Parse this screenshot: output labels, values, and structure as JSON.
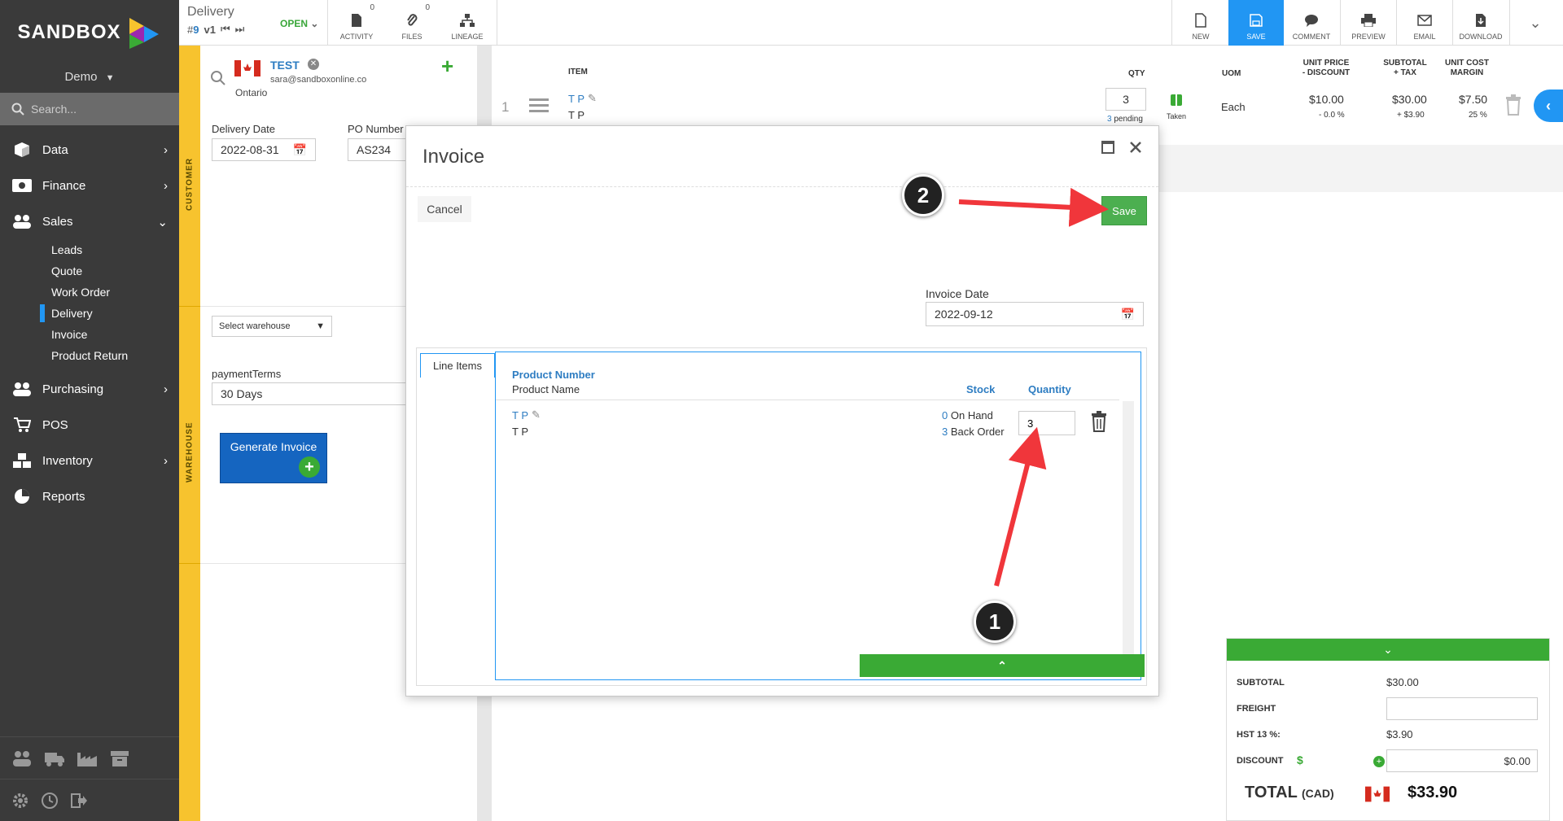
{
  "app": {
    "brand": "SANDBOX",
    "company": "Demo",
    "search_placeholder": "Search..."
  },
  "nav": {
    "data": "Data",
    "finance": "Finance",
    "sales": "Sales",
    "sales_sub": [
      "Leads",
      "Quote",
      "Work Order",
      "Delivery",
      "Invoice",
      "Product Return"
    ],
    "purchasing": "Purchasing",
    "pos": "POS",
    "inventory": "Inventory",
    "reports": "Reports"
  },
  "doc": {
    "type": "Delivery",
    "hash": "#",
    "number": "9",
    "version": "v1",
    "status": "OPEN"
  },
  "toolbar": {
    "activity": "ACTIVITY",
    "activity_count": "0",
    "files": "FILES",
    "files_count": "0",
    "lineage": "LINEAGE",
    "new": "NEW",
    "save": "SAVE",
    "comment": "COMMENT",
    "preview": "PREVIEW",
    "email": "EMAIL",
    "download": "DOWNLOAD"
  },
  "customer": {
    "name": "TEST",
    "email": "sara@sandboxonline.co",
    "province": "Ontario",
    "strip_label": "CUSTOMER",
    "delivery_date_label": "Delivery Date",
    "delivery_date": "2022-08-31",
    "po_label": "PO Number",
    "po_value": "AS234"
  },
  "warehouse": {
    "strip_label": "WAREHOUSE",
    "select_label": "Select warehouse",
    "payment_terms_label": "paymentTerms",
    "payment_terms": "30 Days",
    "generate_invoice": "Generate Invoice"
  },
  "items": {
    "headers": {
      "item": "ITEM",
      "qty": "QTY",
      "uom": "UOM",
      "unit_price": "UNIT PRICE",
      "unit_price_sub": "- DISCOUNT",
      "subtotal": "SUBTOTAL",
      "subtotal_sub": "+ TAX",
      "unit_cost": "UNIT COST",
      "unit_cost_sub": "MARGIN"
    },
    "row": {
      "index": "1",
      "code": "T P",
      "name": "T P",
      "qty": "3",
      "pending_count": "3",
      "pending_label": "pending",
      "taken": "Taken",
      "uom": "Each",
      "unit_price": "$10.00",
      "discount": "- 0.0 %",
      "subtotal": "$30.00",
      "tax": "+ $3.90",
      "unit_cost": "$7.50",
      "margin": "25 %"
    }
  },
  "totals": {
    "subtotal_label": "SUBTOTAL",
    "subtotal": "$30.00",
    "freight_label": "FREIGHT",
    "freight": "",
    "hst_label": "HST 13 %:",
    "hst": "$3.90",
    "discount_label": "DISCOUNT",
    "discount_symbol": "$",
    "discount": "$0.00",
    "total_label": "TOTAL",
    "total_currency": "(CAD)",
    "total": "$33.90"
  },
  "modal": {
    "title": "Invoice",
    "cancel": "Cancel",
    "save": "Save",
    "invoice_date_label": "Invoice Date",
    "invoice_date": "2022-09-12",
    "tab": "Line Items",
    "col_product_number": "Product Number",
    "col_product_name": "Product Name",
    "col_stock": "Stock",
    "col_quantity": "Quantity",
    "line": {
      "code": "T P",
      "name": "T P",
      "on_hand_count": "0",
      "on_hand_label": "On Hand",
      "back_order_count": "3",
      "back_order_label": "Back Order",
      "quantity": "3"
    }
  },
  "annotations": {
    "step1": "1",
    "step2": "2"
  },
  "colors": {
    "accent": "#2196f3",
    "green": "#3aaa35",
    "sidebar": "#3a3a3a",
    "strip": "#f7c32e",
    "arrow": "#f0363b"
  }
}
